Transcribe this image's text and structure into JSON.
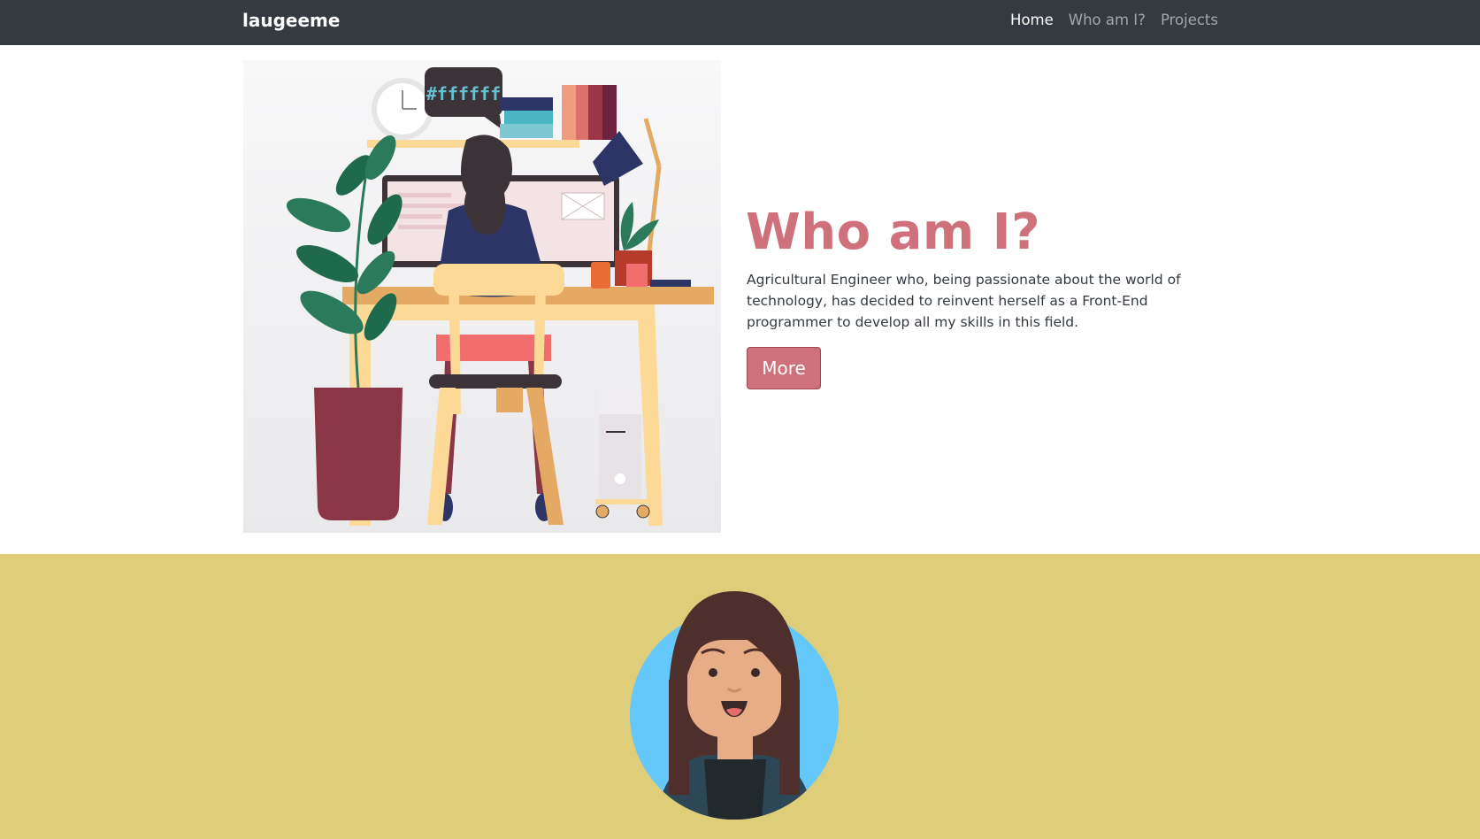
{
  "navbar": {
    "brand": "laugeeme",
    "links": [
      {
        "label": "Home",
        "active": true
      },
      {
        "label": "Who am I?",
        "active": false
      },
      {
        "label": "Projects",
        "active": false
      }
    ]
  },
  "hero": {
    "bubble_text": "#ffffff",
    "title": "Who am I?",
    "text": "Agricultural Engineer who, being passionate about the world of technology, has decided to reinvent herself as a Front-End programmer to develop all my skills in this field.",
    "button_label": "More"
  },
  "colors": {
    "navbar_bg": "#343a40",
    "accent": "#cf717a",
    "about_bg": "#decd79",
    "avatar_bg": "#64c8fb"
  }
}
